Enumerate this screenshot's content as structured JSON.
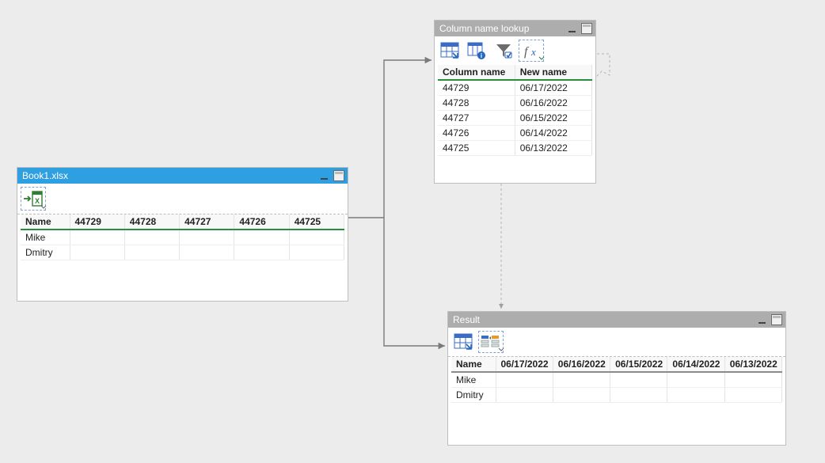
{
  "panels": {
    "source": {
      "title": "Book1.xlsx",
      "table": {
        "headers": [
          "Name",
          "44729",
          "44728",
          "44727",
          "44726",
          "44725"
        ],
        "rows": [
          [
            "Mike",
            "",
            "",
            "",
            "",
            ""
          ],
          [
            "Dmitry",
            "",
            "",
            "",
            "",
            ""
          ]
        ]
      }
    },
    "lookup": {
      "title": "Column name lookup",
      "table": {
        "headers": [
          "Column name",
          "New name"
        ],
        "rows": [
          [
            "44729",
            "06/17/2022"
          ],
          [
            "44728",
            "06/16/2022"
          ],
          [
            "44727",
            "06/15/2022"
          ],
          [
            "44726",
            "06/14/2022"
          ],
          [
            "44725",
            "06/13/2022"
          ]
        ]
      }
    },
    "result": {
      "title": "Result",
      "table": {
        "headers": [
          "Name",
          "06/17/2022",
          "06/16/2022",
          "06/15/2022",
          "06/14/2022",
          "06/13/2022"
        ],
        "rows": [
          [
            "Mike",
            "",
            "",
            "",
            "",
            ""
          ],
          [
            "Dmitry",
            "",
            "",
            "",
            "",
            ""
          ]
        ]
      }
    }
  },
  "icons": {
    "import-excel": "import-excel-icon",
    "table": "table-icon",
    "table-info": "table-info-icon",
    "filter": "filter-icon",
    "fx": "formula-icon",
    "rename-cols": "rename-columns-icon"
  }
}
